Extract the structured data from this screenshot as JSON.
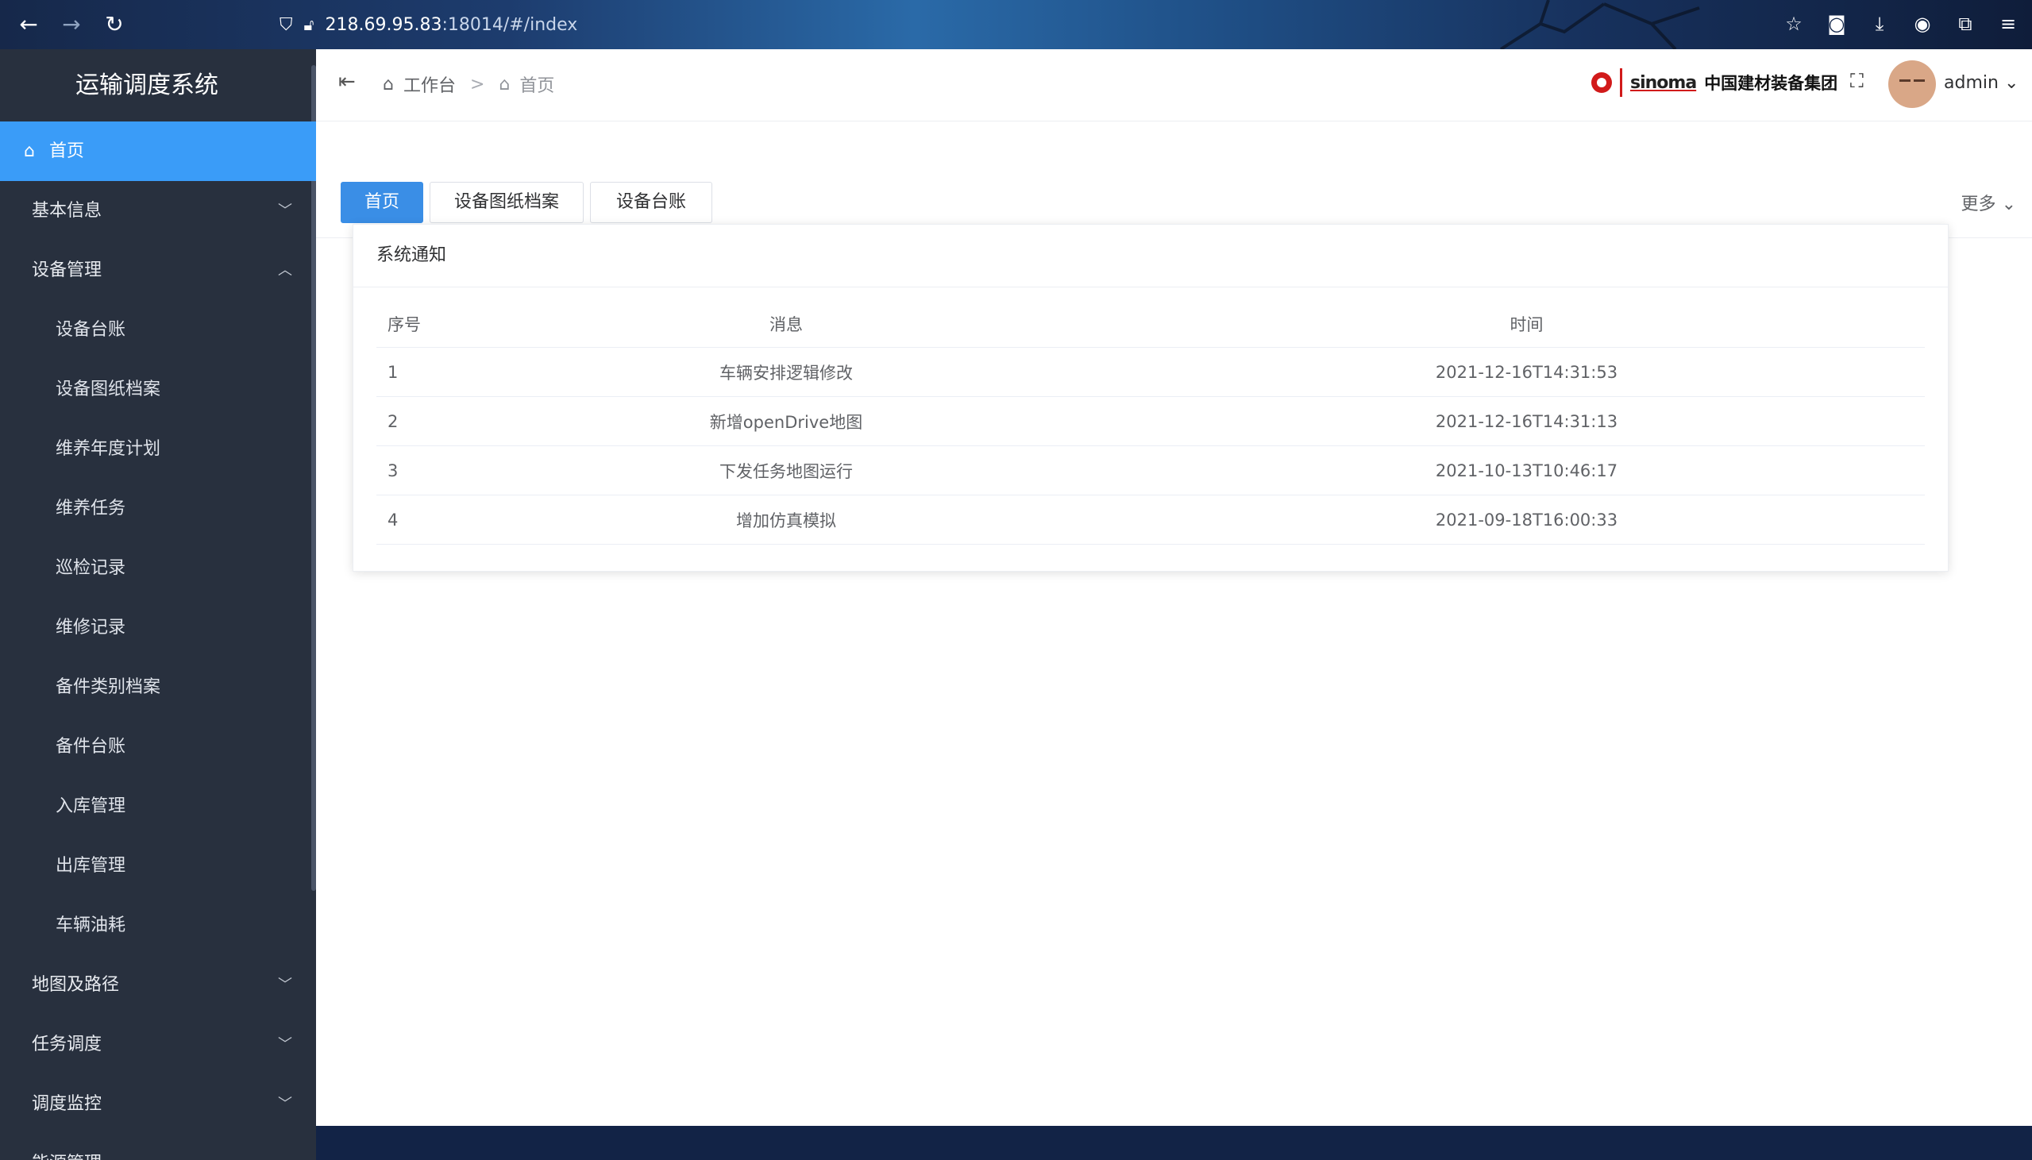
{
  "browser": {
    "url_host": "218.69.95.83",
    "url_rest": ":18014/#/index"
  },
  "app": {
    "title": "运输调度系统"
  },
  "sidebar": {
    "items": [
      {
        "label": "首页"
      },
      {
        "label": "基本信息"
      },
      {
        "label": "设备管理"
      },
      {
        "label": "设备台账"
      },
      {
        "label": "设备图纸档案"
      },
      {
        "label": "维养年度计划"
      },
      {
        "label": "维养任务"
      },
      {
        "label": "巡检记录"
      },
      {
        "label": "维修记录"
      },
      {
        "label": "备件类别档案"
      },
      {
        "label": "备件台账"
      },
      {
        "label": "入库管理"
      },
      {
        "label": "出库管理"
      },
      {
        "label": "车辆油耗"
      },
      {
        "label": "地图及路径"
      },
      {
        "label": "任务调度"
      },
      {
        "label": "调度监控"
      },
      {
        "label": "能源管理"
      }
    ]
  },
  "header": {
    "breadcrumb_root": "工作台",
    "breadcrumb_current": "首页",
    "brand_en": "sinoma",
    "brand_cn": "中国建材装备集团",
    "user": "admin"
  },
  "tabs": {
    "items": [
      {
        "label": "首页"
      },
      {
        "label": "设备图纸档案"
      },
      {
        "label": "设备台账"
      }
    ],
    "more": "更多"
  },
  "notice": {
    "title": "系统通知",
    "columns": [
      "序号",
      "消息",
      "时间"
    ],
    "rows": [
      {
        "no": "1",
        "msg": "车辆安排逻辑修改",
        "time": "2021-12-16T14:31:53"
      },
      {
        "no": "2",
        "msg": "新增openDrive地图",
        "time": "2021-12-16T14:31:13"
      },
      {
        "no": "3",
        "msg": "下发任务地图运行",
        "time": "2021-10-13T10:46:17"
      },
      {
        "no": "4",
        "msg": "增加仿真模拟",
        "time": "2021-09-18T16:00:33"
      }
    ]
  }
}
